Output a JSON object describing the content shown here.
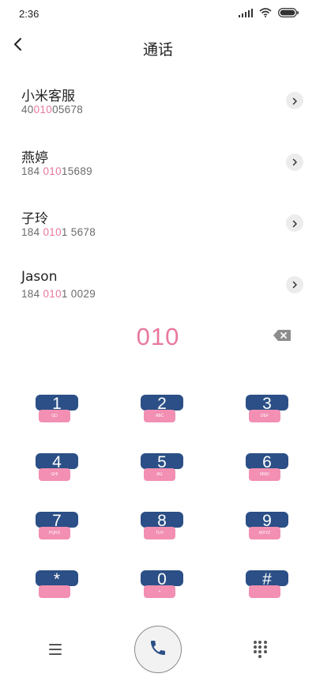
{
  "status": {
    "time": "2:36"
  },
  "header": {
    "title": "通话"
  },
  "contacts": [
    {
      "name": "小米客服",
      "number": {
        "pre": "40",
        "match": "010",
        "post": "05678"
      }
    },
    {
      "name": "燕婷",
      "number": {
        "pre": "184 ",
        "match": "010",
        "post": "15689"
      }
    },
    {
      "name": "子玲",
      "number": {
        "pre": "184 ",
        "match": "010",
        "post": "1 5678"
      }
    },
    {
      "name": "Jason",
      "number": {
        "pre": "184 ",
        "match": "010",
        "post": "1 0029"
      }
    }
  ],
  "dial_input": {
    "value": "010"
  },
  "keypad": [
    {
      "digit": "1",
      "letters": "GD"
    },
    {
      "digit": "2",
      "letters": "ABC"
    },
    {
      "digit": "3",
      "letters": "DEF"
    },
    {
      "digit": "4",
      "letters": "GHI"
    },
    {
      "digit": "5",
      "letters": "JKL"
    },
    {
      "digit": "6",
      "letters": "MNO"
    },
    {
      "digit": "7",
      "letters": "PQRS"
    },
    {
      "digit": "8",
      "letters": "TUV"
    },
    {
      "digit": "9",
      "letters": "WXYZ"
    },
    {
      "digit": "*",
      "letters": ""
    },
    {
      "digit": "0",
      "letters": "+"
    },
    {
      "digit": "#",
      "letters": ""
    }
  ],
  "icons": {
    "back": "chevron-left-icon",
    "detail": "chevron-right-icon",
    "delete": "backspace-icon",
    "menu": "menu-icon",
    "call": "phone-icon",
    "dialpad": "dialpad-icon"
  },
  "colors": {
    "highlight": "#e8799c",
    "key_digit_bg": "#2b4f86",
    "key_letters_bg": "#f28fb2"
  }
}
